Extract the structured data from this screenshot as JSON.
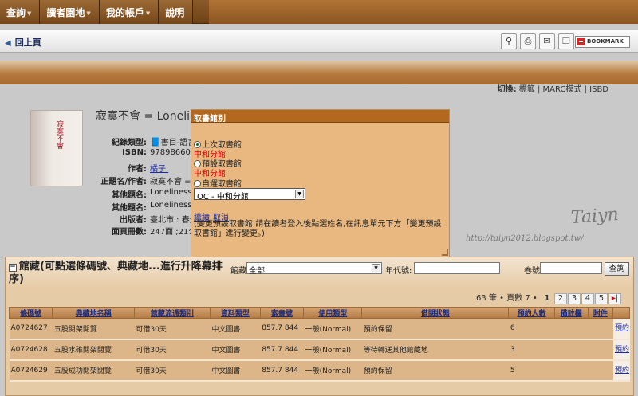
{
  "topnav": {
    "items": [
      "查詢",
      "讀者園地",
      "我的帳戶",
      "說明"
    ]
  },
  "toolbar": {
    "back_label": "回上頁",
    "icons": [
      "user-search-icon",
      "print-icon",
      "mail-icon",
      "export-icon"
    ],
    "bookmark_label": "BOOKMARK"
  },
  "view_switch": {
    "label": "切換:",
    "options": [
      "標籤",
      "MARC模式",
      "ISBD"
    ]
  },
  "record": {
    "title": "寂寞不會 = Loneline",
    "cover_text": "寂寞不會",
    "fields": [
      {
        "label": "紀錄類型:",
        "value": "書目-語言"
      },
      {
        "label": "ISBN:",
        "value": "978986600"
      },
      {
        "label": "作者:",
        "value": "橘子,"
      },
      {
        "label": "正題名/作者:",
        "value": "寂寞不會 = L"
      },
      {
        "label": "其他題名:",
        "value": "Loneliness"
      },
      {
        "label": "其他題名:",
        "value": "Loneliness"
      },
      {
        "label": "出版者:",
        "value": "臺北市 : 春光"
      },
      {
        "label": "面頁冊數:",
        "value": "247面 ;21公"
      }
    ]
  },
  "popup": {
    "title": "取書館別",
    "option_last": "上次取書館",
    "last_branch": "中和分館",
    "option_default": "預設取書館",
    "default_branch": "中和分館",
    "option_custom": "自選取書館",
    "select_value": "OC - 中和分館",
    "continue_label": "繼續",
    "cancel_label": "取消",
    "note": "(變更預設取書館:請在讀者登入後點選姓名,在訊息單元下方「變更預設取書館」進行變更。)"
  },
  "watermark": {
    "signature": "Taiyn",
    "url": "http://taiyn2012.blogspot.tw/"
  },
  "holdings": {
    "title": "館藏(可點選條碼號、典藏地...進行升降幕排序)",
    "location_label": "館藏地:",
    "location_value": "全部",
    "year_label": "年代號:",
    "volume_label": "卷號:",
    "search_button": "查詢",
    "pager_info": "63 筆 • 頁數 7 •",
    "pages": [
      "1",
      "2",
      "3",
      "4",
      "5"
    ],
    "current_page": "1",
    "columns": [
      "條碼號",
      "典藏地名稱",
      "館藏流通類別",
      "資料類型",
      "索書號",
      "使用類型",
      "借閱狀態",
      "預約人數",
      "備註欄",
      "附件",
      ""
    ],
    "rows": [
      [
        "A0724627",
        "五股閱架閱覽",
        "可借30天",
        "中文圖書",
        "857.7 844",
        "一般(Normal)",
        "預約保留",
        "6",
        "",
        "",
        "預約"
      ],
      [
        "A0724628",
        "五股水碓閱架閱覽",
        "可借30天",
        "中文圖書",
        "857.7 844",
        "一般(Normal)",
        "等待轉送其他館藏地",
        "3",
        "",
        "",
        "預約"
      ],
      [
        "A0724629",
        "五股成功閱架閱覽",
        "可借30天",
        "中文圖書",
        "857.7 844",
        "一般(Normal)",
        "預約保留",
        "5",
        "",
        "",
        "預約"
      ]
    ]
  }
}
